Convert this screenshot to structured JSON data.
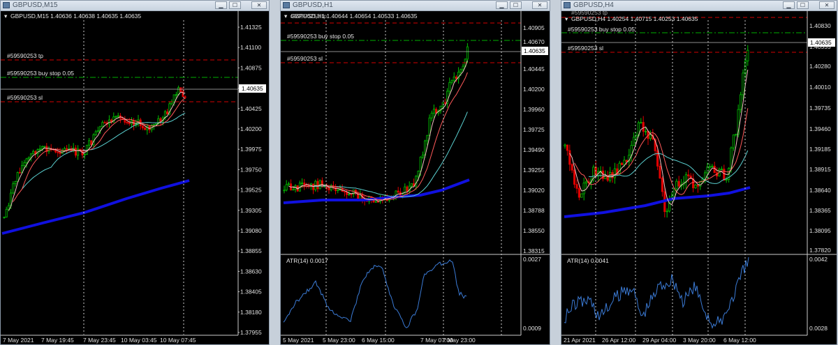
{
  "windows": [
    {
      "title": "GBPUSD,M15",
      "header": "GBPUSD,M15  1.40636 1.40638 1.40635 1.40635",
      "price_ticks": [
        "1.41325",
        "1.41100",
        "1.40875",
        "1.40635",
        "1.40425",
        "1.40200",
        "1.39975",
        "1.39750",
        "1.39525",
        "1.39305",
        "1.39080",
        "1.38855",
        "1.38630",
        "1.38405",
        "1.38180",
        "1.37955"
      ],
      "time_ticks": [
        "7 May 2021",
        "7 May 19:45",
        "7 May 23:45",
        "10 May 03:45",
        "10 May 07:45"
      ],
      "current_price": "1.40635",
      "orders": [
        {
          "label": "#59590253 tp",
          "color": "#d40000"
        },
        {
          "label": "#59590253 buy stop 0.05",
          "color": "#00b000"
        },
        {
          "label": "#59590253 sl",
          "color": "#d40000"
        }
      ]
    },
    {
      "title": "GBPUSD,H1",
      "header": "GBPUSD,H1  1.40644 1.40654 1.40533 1.40635",
      "header_overlap": "#59590253 tp",
      "price_ticks": [
        "1.40905",
        "1.40670",
        "1.40635",
        "1.40445",
        "1.40200",
        "1.39960",
        "1.39725",
        "1.39490",
        "1.39255",
        "1.39020",
        "1.38788",
        "1.38550",
        "1.38315"
      ],
      "time_ticks": [
        "5 May 2021",
        "5 May 23:00",
        "6 May 15:00",
        "7 May 07:00",
        "7 May 23:00"
      ],
      "current_price": "1.40635",
      "orders": [
        {
          "label": "#59590253 buy stop 0.05",
          "color": "#00b000"
        },
        {
          "label": "#59590253 sl",
          "color": "#d40000"
        }
      ],
      "atr_label": "ATR(14) 0.0017",
      "atr_ticks": [
        "0.0027",
        "0.0009"
      ]
    },
    {
      "title": "GBPUSD,H4",
      "header": "GBPUSD,H4  1.40254 1.40715 1.40253 1.40635",
      "header_overlap": "#59590253 tp",
      "price_ticks": [
        "1.40830",
        "1.40635",
        "1.40555",
        "1.40280",
        "1.40010",
        "1.39735",
        "1.39460",
        "1.39185",
        "1.38915",
        "1.38640",
        "1.38365",
        "1.38095",
        "1.37820"
      ],
      "time_ticks": [
        "21 Apr 2021",
        "26 Apr 12:00",
        "29 Apr 04:00",
        "3 May 20:00",
        "6 May 12:00"
      ],
      "current_price": "1.40635",
      "orders": [
        {
          "label": "#59590253 buy stop 0.05",
          "color": "#00b000"
        },
        {
          "label": "#59590253 sl",
          "color": "#d40000"
        }
      ],
      "atr_label": "ATR(14) 0.0041",
      "atr_ticks": [
        "0.0042",
        "0.0028"
      ]
    }
  ],
  "colors": {
    "up": "#00c000",
    "down": "#e00000",
    "ma_fast": "#ffffff",
    "ma_mid": "#ff5a5a",
    "ma_slow": "#5ad0d0",
    "ma_long": "#1010e0",
    "atr": "#3b7bd6"
  }
}
